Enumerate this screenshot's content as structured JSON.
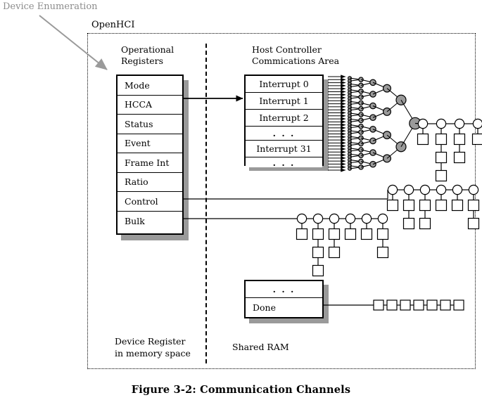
{
  "figure": {
    "caption": "Figure 3-2:  Communication Channels",
    "annotation": "Device Enumeration",
    "enclosure_label": "OpenHCI"
  },
  "colors": {
    "shadow": "#9a9a9a",
    "annotation": "#8c8c8c",
    "node_fill_gray": "#9a9a9a",
    "node_fill_white": "#ffffff",
    "stroke": "#000000",
    "background": "#ffffff"
  },
  "operational_registers": {
    "title_line1": "Operational",
    "title_line2": "Registers",
    "rows": [
      {
        "label": "Mode"
      },
      {
        "label": "HCCA"
      },
      {
        "label": "Status"
      },
      {
        "label": "Event"
      },
      {
        "label": "Frame Int"
      },
      {
        "label": "Ratio"
      },
      {
        "label": "Control"
      },
      {
        "label": "Bulk"
      }
    ]
  },
  "hcca": {
    "title_line1": "Host Controller",
    "title_line2": "Commications Area",
    "rows": [
      {
        "label": "Interrupt 0"
      },
      {
        "label": "Interrupt 1"
      },
      {
        "label": "Interrupt 2"
      },
      {
        "label": ". . ."
      },
      {
        "label": "Interrupt 31"
      },
      {
        "label": ". . ."
      }
    ]
  },
  "done_queue": {
    "rows": [
      {
        "label": ". . ."
      },
      {
        "label": "Done"
      }
    ],
    "td_count": 7
  },
  "footers": {
    "left_line1": "Device Register",
    "left_line2": "in memory space",
    "right": "Shared RAM"
  },
  "chart_data": {
    "type": "diagram",
    "title": "Communication Channels",
    "interrupt_tree": {
      "leaf_arrows": 32,
      "levels": [
        32,
        16,
        8,
        4,
        2,
        1
      ],
      "node_fill": "gray",
      "tail_eds": 4,
      "tail_td_counts": [
        1,
        3,
        2,
        1
      ]
    },
    "control_list": {
      "ed_count": 6,
      "td_counts": [
        1,
        2,
        2,
        1,
        1,
        2
      ]
    },
    "bulk_list": {
      "ed_count": 6,
      "td_counts": [
        1,
        3,
        2,
        1,
        1,
        2
      ]
    },
    "done_list": {
      "td_count": 7
    }
  }
}
